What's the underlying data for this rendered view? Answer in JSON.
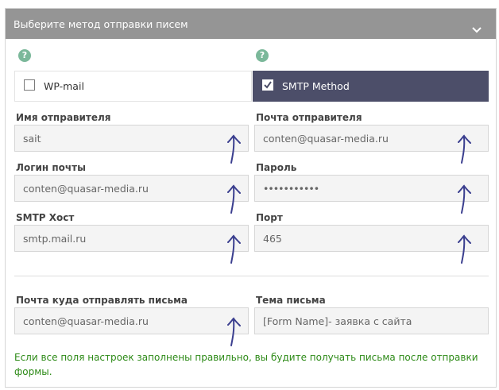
{
  "header": {
    "title": "Выберите метод отправки писем"
  },
  "methods": [
    {
      "label": "WP-mail",
      "checked": false,
      "help": "?"
    },
    {
      "label": "SMTP Method",
      "checked": true,
      "help": "?"
    }
  ],
  "fields": {
    "sender_name": {
      "label": "Имя отправителя",
      "value": "sait"
    },
    "sender_email": {
      "label": "Почта отправителя",
      "value": "conten@quasar-media.ru"
    },
    "login": {
      "label": "Логин почты",
      "value": "conten@quasar-media.ru"
    },
    "password": {
      "label": "Пароль",
      "value": "•••••••••••"
    },
    "smtp_host": {
      "label": "SMTP Хост",
      "value": "smtp.mail.ru"
    },
    "port": {
      "label": "Порт",
      "value": "465"
    },
    "recipient": {
      "label": "Почта куда отправлять письма",
      "value": "conten@quasar-media.ru"
    },
    "subject": {
      "label": "Тема письма",
      "value": "[Form Name]- заявка с сайта"
    }
  },
  "note": "Если все поля настроек заполнены правильно, вы будите получать письма после отправки формы.",
  "colors": {
    "header_bg": "#959595",
    "selected_method_bg": "#4c4e69",
    "note_text": "#2d8a17",
    "help_icon": "#7bb89a",
    "annotation_arrow": "#3b3f8f"
  }
}
